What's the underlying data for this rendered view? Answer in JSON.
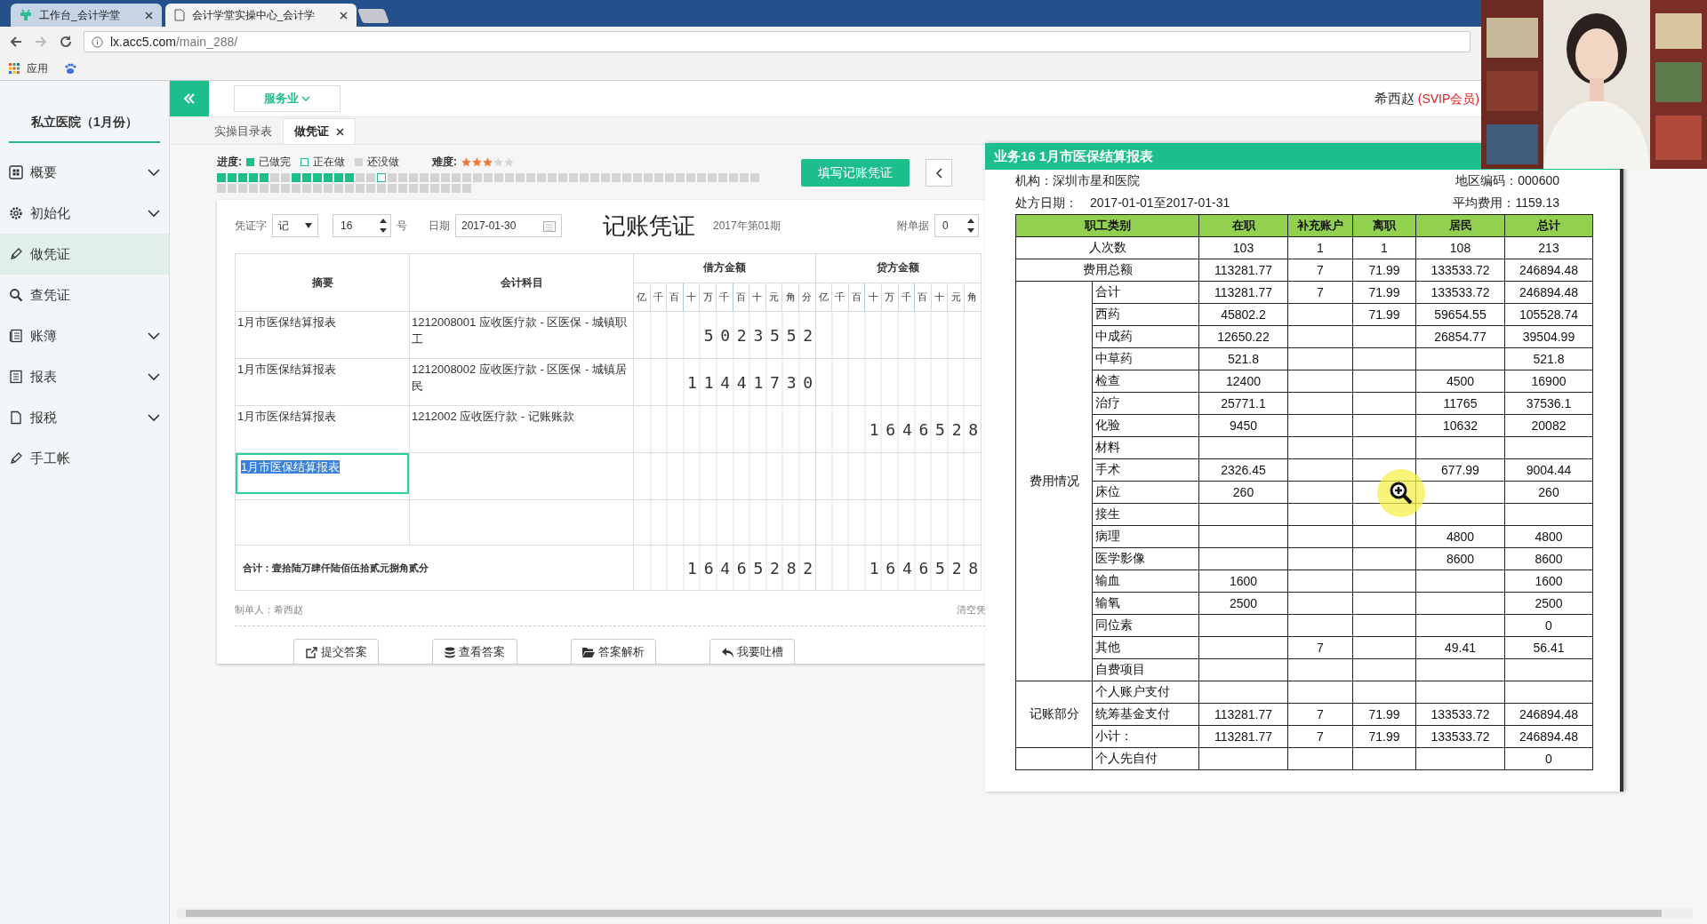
{
  "browser": {
    "tabs": [
      {
        "title": "工作台_会计学堂",
        "selected": false
      },
      {
        "title": "会计学堂实操中心_会计学",
        "selected": true
      }
    ],
    "url_host": "lx.acc5.com",
    "url_path": "/main_288/",
    "bookmark": "应用"
  },
  "sidebar": {
    "title": "私立医院（1月份）",
    "items": [
      {
        "label": "概要",
        "kind": "grid",
        "expandable": true,
        "selected": false
      },
      {
        "label": "初始化",
        "kind": "gear",
        "expandable": true,
        "selected": false
      },
      {
        "label": "做凭证",
        "kind": "pencil",
        "expandable": false,
        "selected": true
      },
      {
        "label": "查凭证",
        "kind": "search",
        "expandable": false,
        "selected": false
      },
      {
        "label": "账簿",
        "kind": "book",
        "expandable": true,
        "selected": false
      },
      {
        "label": "报表",
        "kind": "list",
        "expandable": true,
        "selected": false
      },
      {
        "label": "报税",
        "kind": "file",
        "expandable": true,
        "selected": false
      },
      {
        "label": "手工帐",
        "kind": "pencil",
        "expandable": false,
        "selected": false
      }
    ]
  },
  "header": {
    "industry": "服务业",
    "user": "希西赵",
    "membership": "(SVIP会员)"
  },
  "page_tabs": [
    {
      "label": "实操目录表",
      "selected": false,
      "closable": false
    },
    {
      "label": "做凭证",
      "selected": true,
      "closable": true
    }
  ],
  "progress": {
    "label": "进度:",
    "legend": [
      {
        "kind": "done",
        "label": "已做完"
      },
      {
        "kind": "current",
        "label": "正在做"
      },
      {
        "kind": "todo",
        "label": "还没做"
      }
    ],
    "steps": [
      {
        "kind": "done"
      },
      {
        "kind": "done"
      },
      {
        "kind": "done"
      },
      {
        "kind": "done"
      },
      {
        "kind": "done"
      },
      {
        "kind": "todo"
      },
      {
        "kind": "todo"
      },
      {
        "kind": "done"
      },
      {
        "kind": "done"
      },
      {
        "kind": "done"
      },
      {
        "kind": "done"
      },
      {
        "kind": "done"
      },
      {
        "kind": "done"
      },
      {
        "kind": "todo"
      },
      {
        "kind": "todo"
      },
      {
        "kind": "current"
      },
      {
        "kind": "todo"
      },
      {
        "kind": "todo"
      },
      {
        "kind": "todo"
      },
      {
        "kind": "todo"
      },
      {
        "kind": "todo"
      },
      {
        "kind": "todo"
      },
      {
        "kind": "todo"
      },
      {
        "kind": "todo"
      },
      {
        "kind": "todo"
      },
      {
        "kind": "todo"
      },
      {
        "kind": "todo"
      },
      {
        "kind": "todo"
      },
      {
        "kind": "todo"
      },
      {
        "kind": "todo"
      },
      {
        "kind": "todo"
      },
      {
        "kind": "todo"
      },
      {
        "kind": "todo"
      },
      {
        "kind": "todo"
      },
      {
        "kind": "todo"
      },
      {
        "kind": "todo"
      },
      {
        "kind": "todo"
      },
      {
        "kind": "todo"
      },
      {
        "kind": "todo"
      },
      {
        "kind": "todo"
      },
      {
        "kind": "todo"
      },
      {
        "kind": "todo"
      },
      {
        "kind": "todo"
      },
      {
        "kind": "todo"
      },
      {
        "kind": "todo"
      },
      {
        "kind": "todo"
      },
      {
        "kind": "todo"
      },
      {
        "kind": "todo"
      },
      {
        "kind": "todo"
      },
      {
        "kind": "todo"
      },
      {
        "kind": "todo"
      },
      {
        "kind": "todo"
      },
      {
        "kind": "todo"
      },
      {
        "kind": "todo"
      },
      {
        "kind": "todo"
      },
      {
        "kind": "todo"
      },
      {
        "kind": "todo"
      },
      {
        "kind": "todo"
      },
      {
        "kind": "todo"
      },
      {
        "kind": "todo"
      },
      {
        "kind": "todo"
      },
      {
        "kind": "todo"
      },
      {
        "kind": "todo"
      },
      {
        "kind": "todo"
      },
      {
        "kind": "todo"
      },
      {
        "kind": "todo"
      },
      {
        "kind": "todo"
      },
      {
        "kind": "todo"
      },
      {
        "kind": "todo"
      },
      {
        "kind": "todo"
      },
      {
        "kind": "todo"
      },
      {
        "kind": "todo"
      },
      {
        "kind": "todo"
      },
      {
        "kind": "todo"
      },
      {
        "kind": "todo"
      }
    ],
    "difficulty_label": "难度:",
    "stars": 3
  },
  "fill_button": "填写记账凭证",
  "voucher": {
    "word_label": "凭证字",
    "word": "记",
    "number": "16",
    "number_suffix": "号",
    "date_label": "日期",
    "date": "2017-01-30",
    "title": "记账凭证",
    "period": "2017年第01期",
    "attachments_label": "附单据",
    "attachments": "0",
    "columns": {
      "summary": "摘要",
      "account": "会计科目",
      "debit": "借方金额",
      "credit": "贷方金额"
    },
    "debit_units": [
      "亿",
      "千",
      "百",
      "十",
      "万",
      "千",
      "百",
      "十",
      "元",
      "角",
      "分"
    ],
    "credit_units": [
      "亿",
      "千",
      "百",
      "十",
      "万",
      "千",
      "百",
      "十",
      "元",
      "角"
    ],
    "entries": [
      {
        "summary": "1月市医保结算报表",
        "account": "1212008001 应收医疗款 - 区医保 - 城镇职工",
        "debit": "5 0 2 3 5 5 2",
        "editing": false
      },
      {
        "summary": "1月市医保结算报表",
        "account": "1212008002 应收医疗款 - 区医保 - 城镇居民",
        "debit": "1 1 4 4 1 7 3 0",
        "editing": false
      },
      {
        "summary": "1月市医保结算报表",
        "account": "1212002 应收医疗款 - 记账账款",
        "credit": "1 6 4 6 5 2 8",
        "editing": false
      },
      {
        "summary": "1月市医保结算报表",
        "editing": true
      }
    ],
    "total_label": "合计：壹拾陆万肆仟陆佰伍拾贰元捌角贰分",
    "total_debit": "1 6 4 6 5 2 8 2",
    "total_credit": "1 6 4 6 5 2 8",
    "maker": "制单人：希西赵",
    "clear": "清空凭"
  },
  "actions": [
    {
      "label": "提交答案",
      "kind": "submit"
    },
    {
      "label": "查看答案",
      "kind": "view"
    },
    {
      "label": "答案解析",
      "kind": "analysis"
    },
    {
      "label": "我要吐槽",
      "kind": "feedback"
    }
  ],
  "report": {
    "title": "业务16 1月市医保结算报表",
    "org": "机构：深圳市星和医院",
    "region": "地区编码：000600",
    "date_label": "处方日期：",
    "date": "2017-01-01至2017-01-31",
    "average": "平均费用：1159.13",
    "columns": [
      "职工类别",
      "在职",
      "补充账户",
      "离职",
      "居民",
      "总计"
    ],
    "blocks": [
      {
        "kind": "single",
        "label": "人次数",
        "cells": {
          "on_job": "103",
          "supplement": "1",
          "retired": "1",
          "resident": "108",
          "total": "213"
        }
      },
      {
        "kind": "single",
        "label": "费用总额",
        "cells": {
          "on_job": "113281.77",
          "supplement": "7",
          "retired": "71.99",
          "resident": "133533.72",
          "total": "246894.48"
        }
      },
      {
        "kind": "group",
        "label": "费用情况",
        "rows": [
          {
            "label": "合计",
            "cells": {
              "on_job": "113281.77",
              "supplement": "7",
              "retired": "71.99",
              "resident": "133533.72",
              "total": "246894.48"
            }
          },
          {
            "label": "西药",
            "cells": {
              "on_job": "45802.2",
              "retired": "71.99",
              "resident": "59654.55",
              "total": "105528.74"
            }
          },
          {
            "label": "中成药",
            "cells": {
              "on_job": "12650.22",
              "resident": "26854.77",
              "total": "39504.99"
            }
          },
          {
            "label": "中草药",
            "cells": {
              "on_job": "521.8",
              "total": "521.8"
            }
          },
          {
            "label": "检查",
            "cells": {
              "on_job": "12400",
              "resident": "4500",
              "total": "16900"
            }
          },
          {
            "label": "治疗",
            "cells": {
              "on_job": "25771.1",
              "resident": "11765",
              "total": "37536.1"
            }
          },
          {
            "label": "化验",
            "cells": {
              "on_job": "9450",
              "resident": "10632",
              "total": "20082"
            }
          },
          {
            "label": "材料",
            "cells": {}
          },
          {
            "label": "手术",
            "cells": {
              "on_job": "2326.45",
              "resident": "677.99",
              "total": "9004.44"
            }
          },
          {
            "label": "床位",
            "cells": {
              "on_job": "260",
              "total": "260"
            }
          },
          {
            "label": "接生",
            "cells": {}
          },
          {
            "label": "病理",
            "cells": {
              "resident": "4800",
              "total": "4800"
            }
          },
          {
            "label": "医学影像",
            "cells": {
              "resident": "8600",
              "total": "8600"
            }
          },
          {
            "label": "输血",
            "cells": {
              "on_job": "1600",
              "total": "1600"
            }
          },
          {
            "label": "输氧",
            "cells": {
              "on_job": "2500",
              "total": "2500"
            }
          },
          {
            "label": "同位素",
            "cells": {
              "total": "0"
            }
          },
          {
            "label": "其他",
            "cells": {
              "supplement": "7",
              "resident": "49.41",
              "total": "56.41"
            }
          },
          {
            "label": "自费项目",
            "cells": {}
          }
        ]
      },
      {
        "kind": "group",
        "label": "记账部分",
        "rows": [
          {
            "label": "个人账户支付",
            "cells": {}
          },
          {
            "label": "统筹基金支付",
            "cells": {
              "on_job": "113281.77",
              "supplement": "7",
              "retired": "71.99",
              "resident": "133533.72",
              "total": "246894.48"
            }
          },
          {
            "label": "小计：",
            "cells": {
              "on_job": "113281.77",
              "supplement": "7",
              "retired": "71.99",
              "resident": "133533.72",
              "total": "246894.48"
            }
          }
        ]
      },
      {
        "kind": "group",
        "rows": [
          {
            "label": "个人先自付",
            "cells": {
              "total": "0"
            }
          }
        ]
      }
    ]
  }
}
